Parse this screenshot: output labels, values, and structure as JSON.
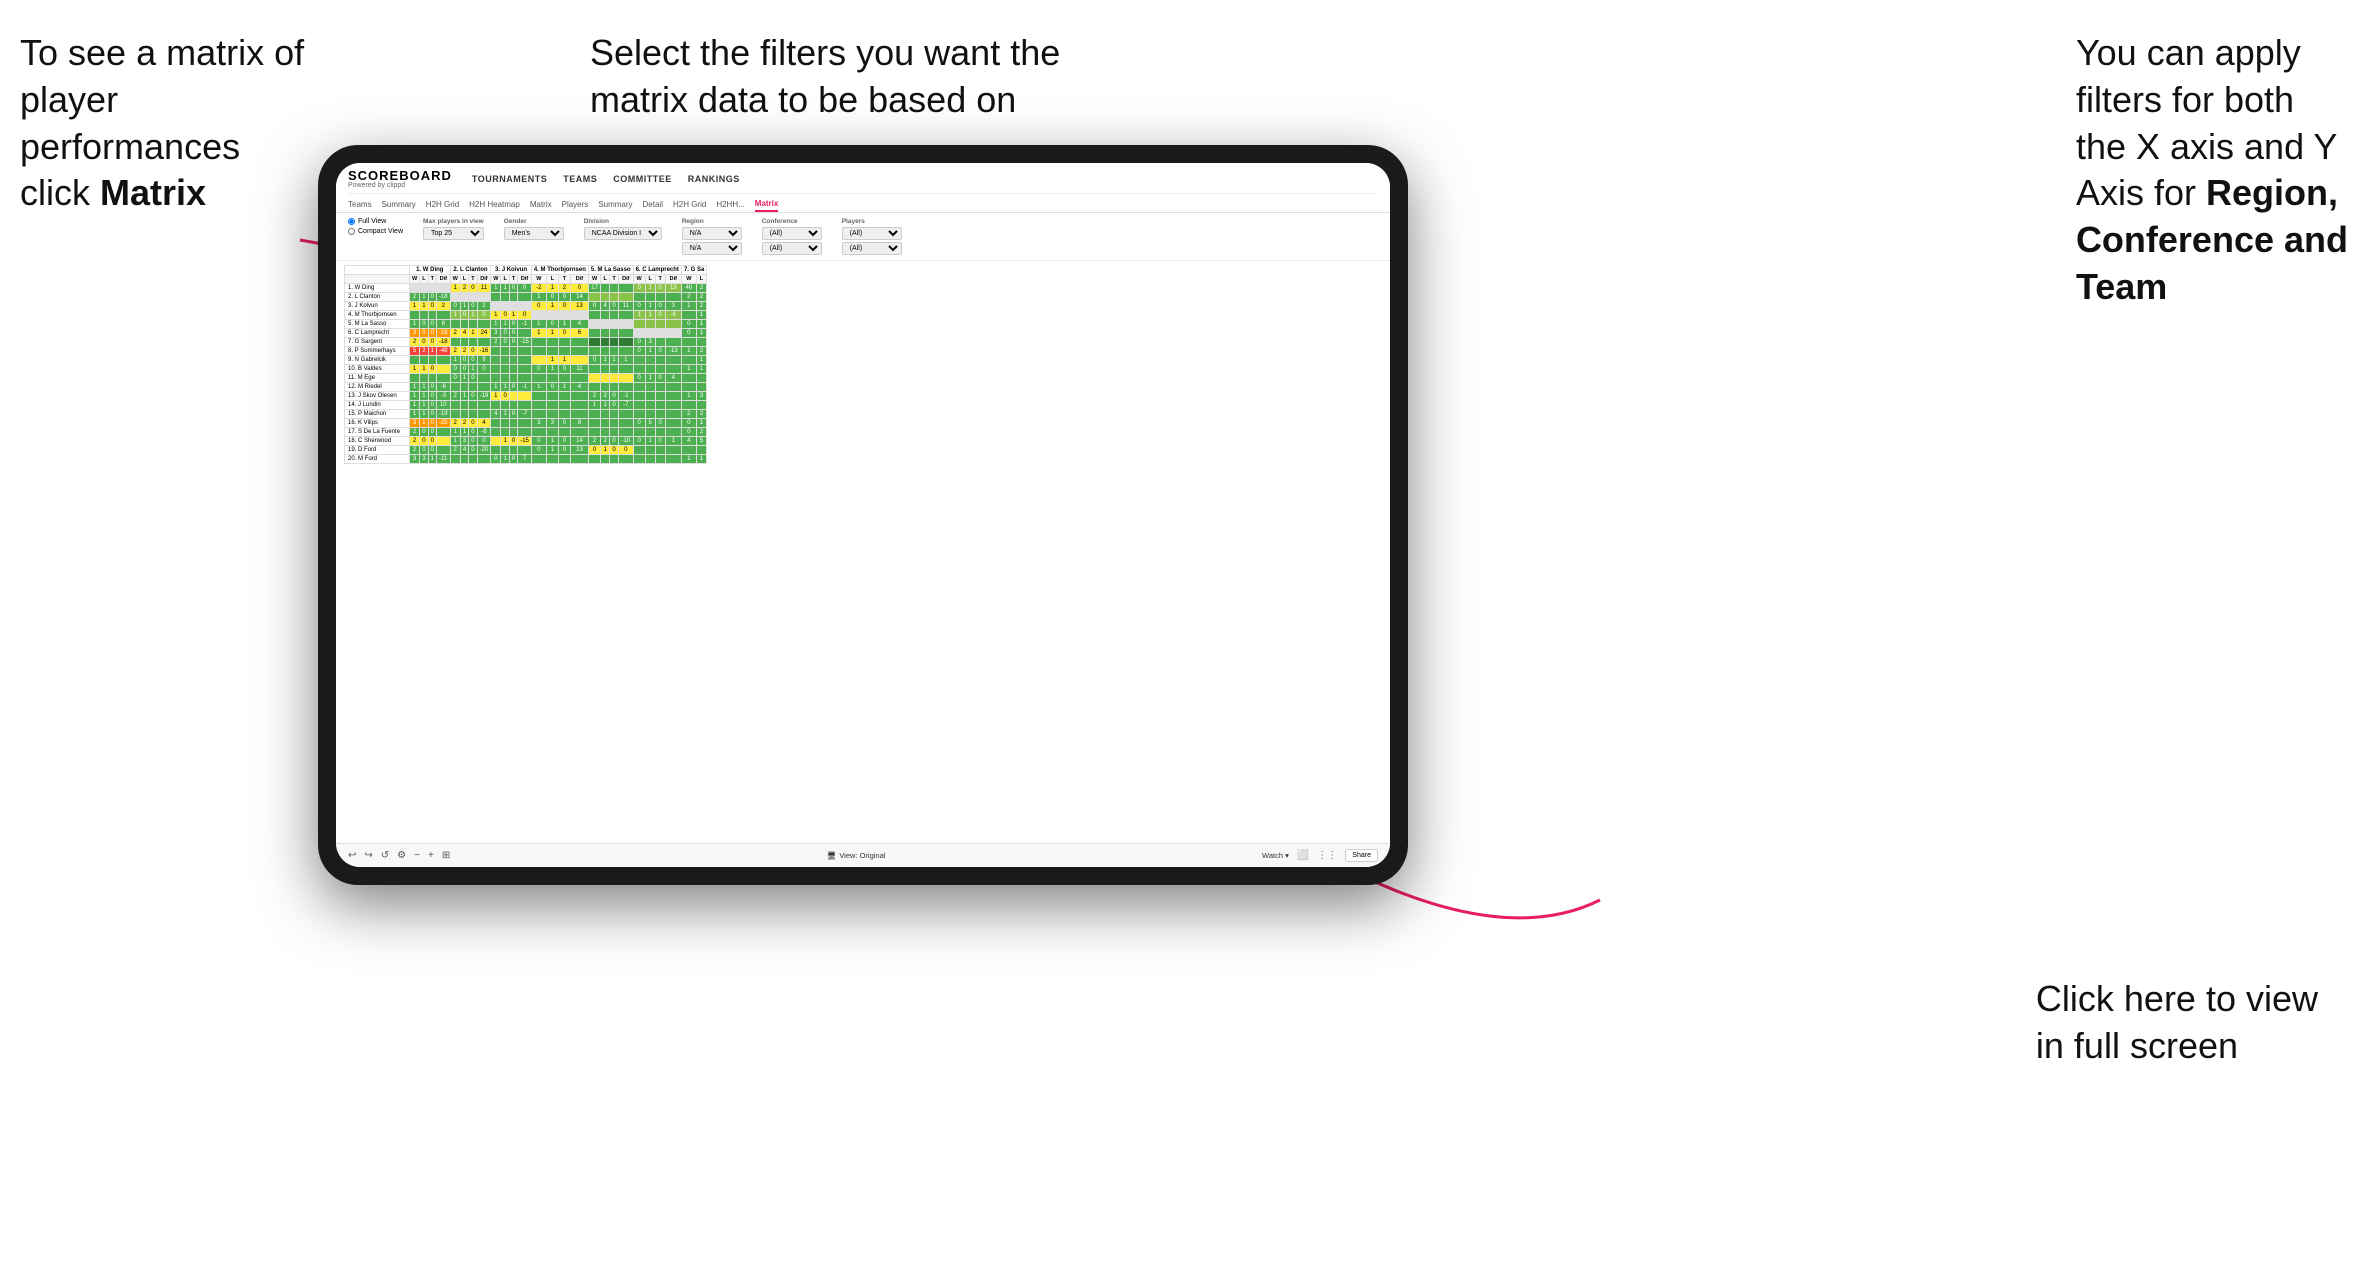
{
  "annotations": {
    "topleft": {
      "line1": "To see a matrix of",
      "line2": "player performances",
      "line3_plain": "click ",
      "line3_bold": "Matrix"
    },
    "topmid": {
      "text": "Select the filters you want the matrix data to be based on"
    },
    "topright": {
      "line1": "You  can apply",
      "line2": "filters for both",
      "line3": "the X axis and Y",
      "line4_plain": "Axis for ",
      "line4_bold": "Region,",
      "line5_bold": "Conference and",
      "line6_bold": "Team"
    },
    "bottomright": {
      "line1": "Click here to view",
      "line2": "in full screen"
    }
  },
  "scoreboard": {
    "logo": "SCOREBOARD",
    "powered_by": "Powered by clippd",
    "nav": [
      "TOURNAMENTS",
      "TEAMS",
      "COMMITTEE",
      "RANKINGS"
    ],
    "sub_nav": [
      "Teams",
      "Summary",
      "H2H Grid",
      "H2H Heatmap",
      "Matrix",
      "Players",
      "Summary",
      "Detail",
      "H2H Grid",
      "H2HH...",
      "Matrix"
    ]
  },
  "filters": {
    "view_options": [
      "Full View",
      "Compact View"
    ],
    "max_players_label": "Max players in view",
    "max_players_value": "Top 25",
    "gender_label": "Gender",
    "gender_value": "Men's",
    "division_label": "Division",
    "division_value": "NCAA Division I",
    "region_label": "Region",
    "region_value1": "N/A",
    "region_value2": "N/A",
    "conference_label": "Conference",
    "conference_value1": "(All)",
    "conference_value2": "(All)",
    "players_label": "Players",
    "players_value1": "(All)",
    "players_value2": "(All)"
  },
  "matrix_headers": [
    "1. W Ding",
    "2. L Clanton",
    "3. J Koivun",
    "4. M Thorbjornsen",
    "5. M La Sasso",
    "6. C Lamprecht",
    "7. G Sa"
  ],
  "players": [
    "1. W Ding",
    "2. L Clanton",
    "3. J Kolvun",
    "4. M Thorbjornsen",
    "5. M La Sasso",
    "6. C Lamprecht",
    "7. G Sargent",
    "8. P Summerhays",
    "9. N Gabrelcik",
    "10. B Valdes",
    "11. M Ege",
    "12. M Riedel",
    "13. J Skov Olesen",
    "14. J Lundin",
    "15. P Maichon",
    "16. K Vilips",
    "17. S De La Fuente",
    "18. C Sherwood",
    "19. D Ford",
    "20. M Ford"
  ],
  "toolbar": {
    "view_original": "View: Original",
    "watch": "Watch ▾",
    "share": "Share"
  }
}
